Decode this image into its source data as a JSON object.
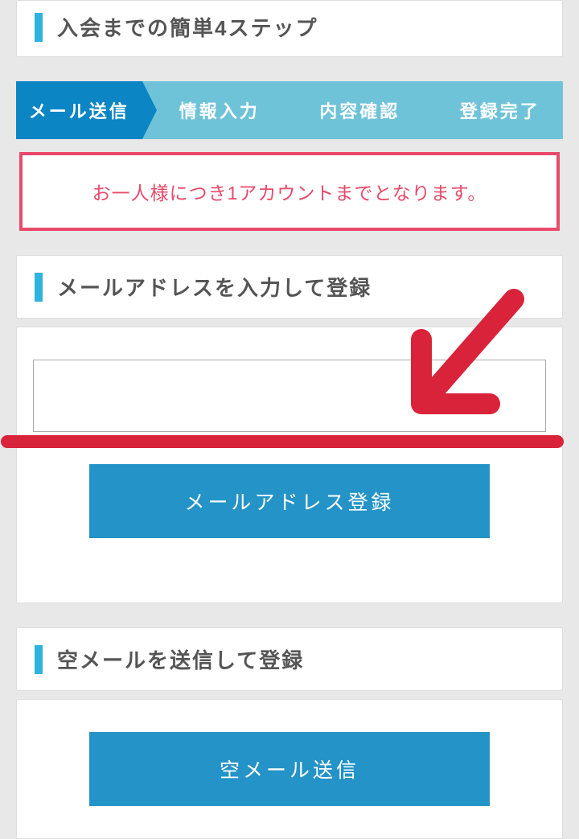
{
  "header": {
    "title": "入会までの簡単4ステップ"
  },
  "steps": [
    {
      "label": "メール送信",
      "active": true
    },
    {
      "label": "情報入力",
      "active": false
    },
    {
      "label": "内容確認",
      "active": false
    },
    {
      "label": "登録完了",
      "active": false
    }
  ],
  "notice": {
    "text": "お一人様につき1アカウントまでとなります。"
  },
  "email_section": {
    "title": "メールアドレスを入力して登録",
    "input_value": "",
    "submit_label": "メールアドレス登録"
  },
  "empty_mail_section": {
    "title": "空メールを送信して登録",
    "submit_label": "空メール送信"
  },
  "annotation": {
    "color": "#d8233a"
  }
}
